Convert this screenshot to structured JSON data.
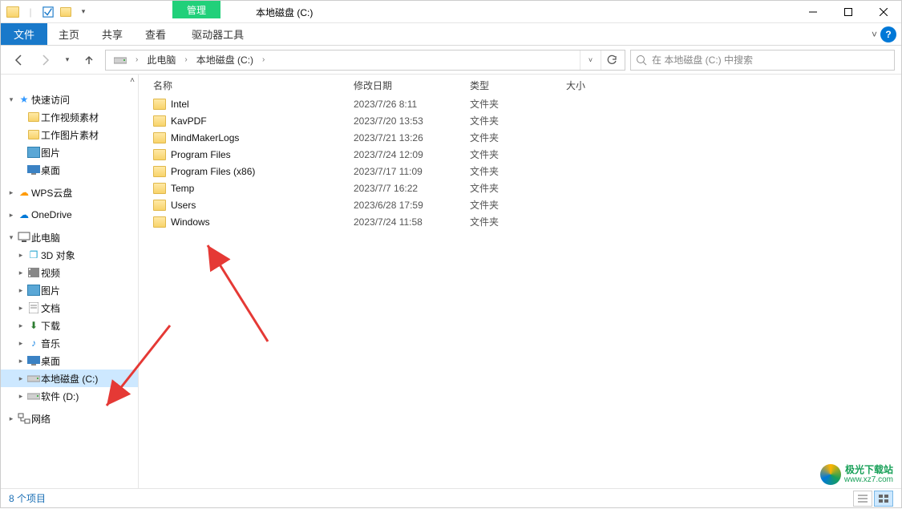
{
  "titlebar": {
    "context_tab": "管理",
    "title": "本地磁盘 (C:)"
  },
  "ribbon": {
    "file": "文件",
    "tabs": [
      "主页",
      "共享",
      "查看"
    ],
    "context_tool": "驱动器工具"
  },
  "address": {
    "segments": [
      "此电脑",
      "本地磁盘 (C:)"
    ]
  },
  "search": {
    "placeholder": "在 本地磁盘 (C:) 中搜索"
  },
  "nav": {
    "quick_access": "快速访问",
    "quick_items": [
      "工作视频素材",
      "工作图片素材",
      "图片",
      "桌面"
    ],
    "wps": "WPS云盘",
    "onedrive": "OneDrive",
    "this_pc": "此电脑",
    "pc_items": [
      "3D 对象",
      "视频",
      "图片",
      "文档",
      "下载",
      "音乐",
      "桌面",
      "本地磁盘 (C:)",
      "软件 (D:)"
    ],
    "network": "网络"
  },
  "columns": {
    "name": "名称",
    "date": "修改日期",
    "type": "类型",
    "size": "大小"
  },
  "rows": [
    {
      "name": "Intel",
      "date": "2023/7/26 8:11",
      "type": "文件夹"
    },
    {
      "name": "KavPDF",
      "date": "2023/7/20 13:53",
      "type": "文件夹"
    },
    {
      "name": "MindMakerLogs",
      "date": "2023/7/21 13:26",
      "type": "文件夹"
    },
    {
      "name": "Program Files",
      "date": "2023/7/24 12:09",
      "type": "文件夹"
    },
    {
      "name": "Program Files (x86)",
      "date": "2023/7/17 11:09",
      "type": "文件夹"
    },
    {
      "name": "Temp",
      "date": "2023/7/7 16:22",
      "type": "文件夹"
    },
    {
      "name": "Users",
      "date": "2023/6/28 17:59",
      "type": "文件夹"
    },
    {
      "name": "Windows",
      "date": "2023/7/24 11:58",
      "type": "文件夹"
    }
  ],
  "status": {
    "count": "8 个项目"
  },
  "watermark": {
    "name": "极光下载站",
    "url": "www.xz7.com"
  }
}
